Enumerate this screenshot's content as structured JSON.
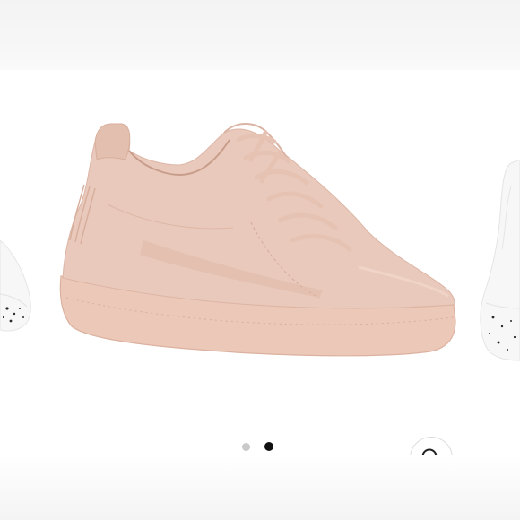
{
  "gallery": {
    "slides": [
      {
        "name": "white-sneaker-partial-left",
        "active": false
      },
      {
        "name": "blush-suede-sneaker",
        "active": true
      },
      {
        "name": "white-sneaker-partial-right",
        "active": false
      }
    ],
    "zoom_icon": "magnifier-icon",
    "pagination": {
      "count": 2,
      "active_index": 1
    },
    "colors": {
      "suede": "#e9c9bb",
      "suede_shadow": "#d9b2a2",
      "sole": "#ecc8b8",
      "sole_edge": "#dcb19f",
      "laces": "#e6c2b3",
      "white_shoe": "#f7f7f7",
      "speckle": "#2b2b2b",
      "dot_active": "#111111",
      "dot_inactive": "#c9c9c9"
    }
  }
}
